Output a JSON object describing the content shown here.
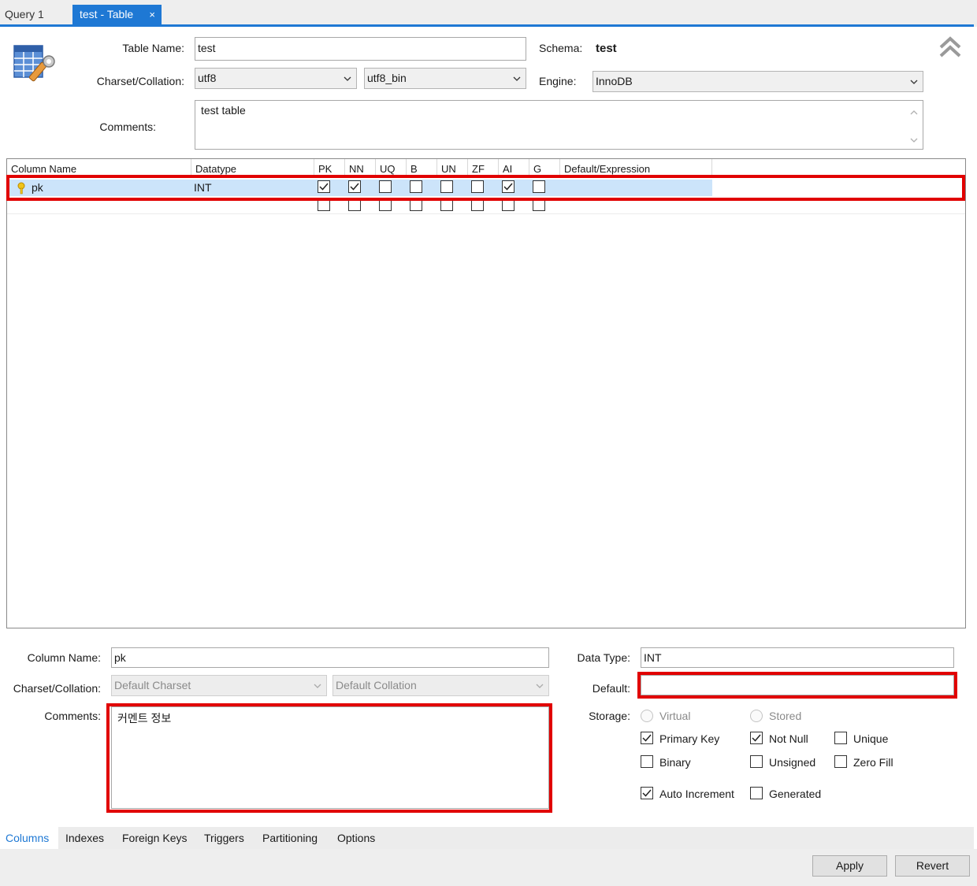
{
  "tabs": {
    "query": "Query 1",
    "active": "test - Table",
    "close": "×"
  },
  "table": {
    "name_label": "Table Name:",
    "name_value": "test",
    "schema_label": "Schema:",
    "schema_value": "test",
    "charset_label": "Charset/Collation:",
    "charset_value": "utf8",
    "collation_value": "utf8_bin",
    "engine_label": "Engine:",
    "engine_value": "InnoDB",
    "comments_label": "Comments:",
    "comments_value": "test table"
  },
  "grid": {
    "headers": [
      "Column Name",
      "Datatype",
      "PK",
      "NN",
      "UQ",
      "B",
      "UN",
      "ZF",
      "AI",
      "G",
      "Default/Expression"
    ],
    "rows": [
      {
        "name": "pk",
        "datatype": "INT",
        "flags": {
          "PK": true,
          "NN": true,
          "UQ": false,
          "B": false,
          "UN": false,
          "ZF": false,
          "AI": true,
          "G": false
        },
        "default": ""
      }
    ]
  },
  "column_detail": {
    "name_label": "Column Name:",
    "name_value": "pk",
    "charset_label": "Charset/Collation:",
    "charset_placeholder": "Default Charset",
    "collation_placeholder": "Default Collation",
    "comments_label": "Comments:",
    "comments_value": "커멘트 정보",
    "datatype_label": "Data Type:",
    "datatype_value": "INT",
    "default_label": "Default:",
    "default_value": "",
    "storage_label": "Storage:",
    "storage": {
      "virtual": "Virtual",
      "stored": "Stored"
    },
    "options": {
      "primary_key": {
        "label": "Primary Key",
        "checked": true
      },
      "not_null": {
        "label": "Not Null",
        "checked": true
      },
      "unique": {
        "label": "Unique",
        "checked": false
      },
      "binary": {
        "label": "Binary",
        "checked": false
      },
      "unsigned": {
        "label": "Unsigned",
        "checked": false
      },
      "zero_fill": {
        "label": "Zero Fill",
        "checked": false
      },
      "auto_increment": {
        "label": "Auto Increment",
        "checked": true
      },
      "generated": {
        "label": "Generated",
        "checked": false
      }
    }
  },
  "bottom_tabs": [
    "Columns",
    "Indexes",
    "Foreign Keys",
    "Triggers",
    "Partitioning",
    "Options"
  ],
  "buttons": {
    "apply": "Apply",
    "revert": "Revert"
  },
  "colors": {
    "accent": "#1e78d4",
    "highlight": "#e10000",
    "selected_row": "#cce4fa"
  }
}
